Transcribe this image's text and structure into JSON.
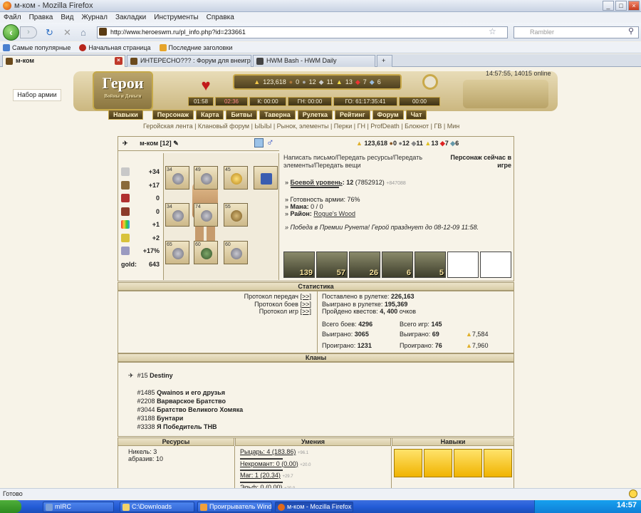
{
  "window": {
    "title": "м-ком - Mozilla Firefox",
    "controls": [
      "_",
      "□",
      "×"
    ]
  },
  "menu": [
    "Файл",
    "Правка",
    "Вид",
    "Журнал",
    "Закладки",
    "Инструменты",
    "Справка"
  ],
  "url": "http://www.heroeswm.ru/pl_info.php?id=233661",
  "search_placeholder": "Rambler",
  "bookmarks": [
    "Самые популярные",
    "Начальная страница",
    "Последние заголовки"
  ],
  "tabs": [
    {
      "label": "м-ком",
      "active": true
    },
    {
      "label": "ИНТЕРЕСНО??? : Форум для внеигров..."
    },
    {
      "label": "HWM Bash - HWM Daily"
    }
  ],
  "army_button": "Набор армии",
  "online": "14:57:55, 14015 online",
  "logo": {
    "main": "Герои",
    "sub": "Войны и Деньги"
  },
  "top_resources": [
    "123,618",
    "0",
    "12",
    "11",
    "13",
    "7",
    "6"
  ],
  "time_bar": [
    "01:58",
    "02:36",
    "К: 00:00",
    "ГН: 00:00",
    "ГО: 61:17:35:41",
    "00:00"
  ],
  "nav": [
    "Навыки",
    "Персонаж",
    "Карта",
    "Битвы",
    "Таверна",
    "Рулетка",
    "Рейтинг",
    "Форум",
    "Чат"
  ],
  "links": "Геройская лента | Клановый форум | ЫЫЫ | Рынок, элементы | Перки | ГН | ProfDeath | Блокнот | ГВ | Мин",
  "character": {
    "name": "м-ком",
    "level_tag": "[12]",
    "resources": [
      "123,618",
      "0",
      "12",
      "11",
      "13",
      "7",
      "6"
    ],
    "stats": [
      {
        "icon": "attack-icon",
        "value": "+34"
      },
      {
        "icon": "defense-icon",
        "value": "+17"
      },
      {
        "icon": "spellpower-icon",
        "value": "0"
      },
      {
        "icon": "knowledge-icon",
        "value": "0"
      },
      {
        "icon": "luck-icon",
        "value": "+1"
      },
      {
        "icon": "morale-icon",
        "value": "+2"
      },
      {
        "icon": "initiative-icon",
        "value": "+17%"
      }
    ],
    "gold_label": "gold:",
    "gold_value": "643",
    "slots": [
      "34",
      "49",
      "45",
      "",
      "34",
      "74",
      "55",
      "65",
      "60",
      "60"
    ],
    "actions": "Написать письмо/Передать ресурсы/Передать элементы/Передать вещи",
    "in_game": "Персонаж сейчас в игре",
    "combat_level_label": "Боевой уровень",
    "combat_level": "12",
    "combat_exp": "(7852912)",
    "combat_exp_extra": "+847088",
    "army_ready": "Готовность армии: 76%",
    "mana_label": "Мана:",
    "mana": "0 / 0",
    "district_label": "Район:",
    "district": "Rogue's Wood",
    "victory": "Победа в Премии Рунета! Герой празднует до 08-12-09 11:58.",
    "army": [
      "139",
      "57",
      "26",
      "6",
      "5",
      "",
      ""
    ]
  },
  "stats_section": {
    "title": "Статистика",
    "protocols": [
      "Протокол передач",
      "Протокол боев",
      "Протокол игр"
    ],
    "protocol_link": "[>>]",
    "roulette_bet_label": "Поставлено в рулетке:",
    "roulette_bet": "226,163",
    "roulette_won_label": "Выиграно в рулетке:",
    "roulette_won": "195,369",
    "quests_label": "Пройдено квестов:",
    "quests": "4, 400",
    "quests_suffix": "очков",
    "battles_label": "Всего боев:",
    "battles": "4296",
    "games_label": "Всего игр:",
    "games": "145",
    "won_label": "Выиграно:",
    "won_battles": "3065",
    "won_games": "69",
    "won_gold": "7,584",
    "lost_label": "Проиграно:",
    "lost_battles": "1231",
    "lost_games": "76",
    "lost_gold": "7,960"
  },
  "clans": {
    "title": "Кланы",
    "list": [
      {
        "num": "#15",
        "name": "Destiny"
      },
      {
        "num": "#1485",
        "name": "Qwainos и его друзья"
      },
      {
        "num": "#2208",
        "name": "Варварское Братство"
      },
      {
        "num": "#3044",
        "name": "Братство Великого Хомяка"
      },
      {
        "num": "#3188",
        "name": "Бунтари"
      },
      {
        "num": "#3338",
        "name": "Я Победитель ТНВ"
      }
    ]
  },
  "bottom": {
    "resources_title": "Ресурсы",
    "skills_title": "Умения",
    "perks_title": "Навыки",
    "resources": [
      "Никель: 3",
      "абразив: 10"
    ],
    "skills": [
      {
        "label": "Рыцарь: 4 (183.86)",
        "extra": "+96.1"
      },
      {
        "label": "Некромант: 0 (0.00)",
        "extra": "+20.0"
      },
      {
        "label": "Маг: 1 (20.34)",
        "extra": "+29.7"
      },
      {
        "label": "Эльф: 0 (0.00)",
        "extra": "+20.0"
      }
    ]
  },
  "status": "Готово",
  "taskbar": {
    "items": [
      "mIRC",
      "C:\\Downloads",
      "Проигрыватель Wind...",
      "м-ком - Mozilla Firefox"
    ],
    "clock": "14:57"
  }
}
